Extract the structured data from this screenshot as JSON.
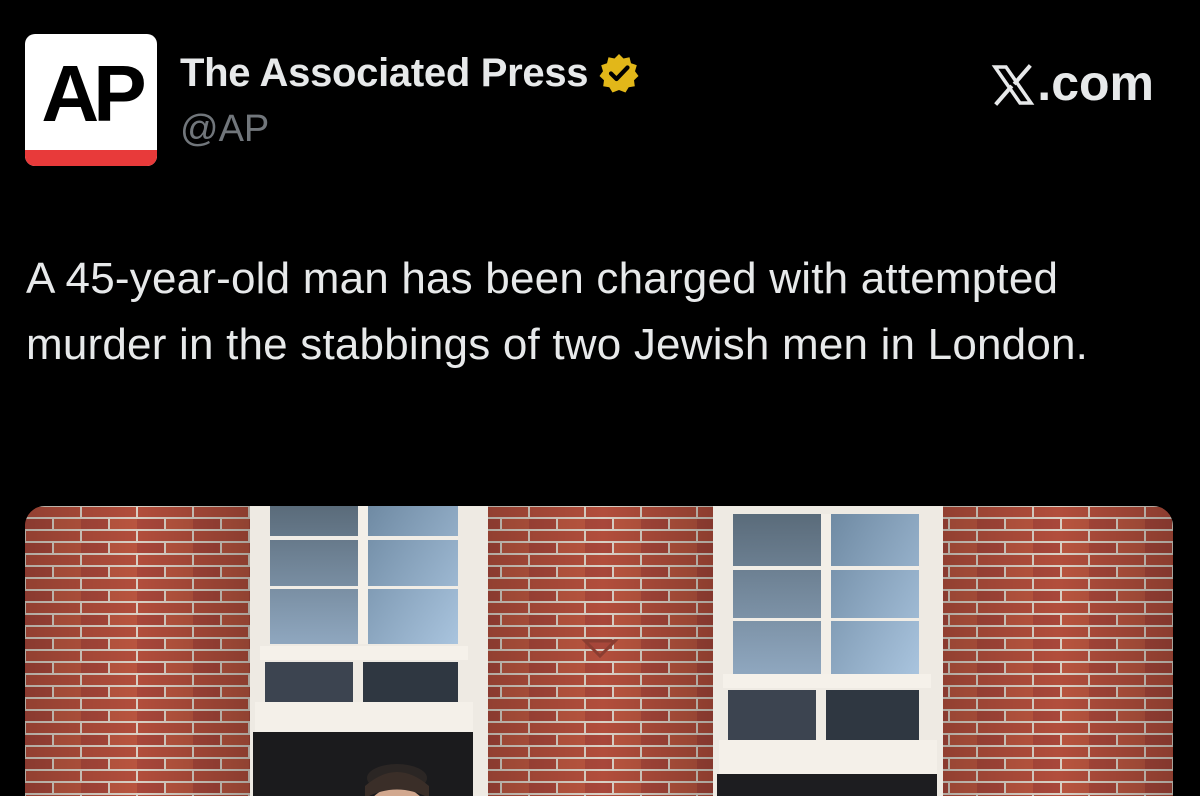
{
  "author": {
    "avatar_text": "AP",
    "display_name": "The Associated Press",
    "handle": "@AP",
    "verified": true,
    "verified_color": "#e2b719"
  },
  "site_mark": {
    "label": ".com",
    "logo_icon": "x-logo-icon"
  },
  "tweet": {
    "text": "A 45-year-old man has been charged with attempted murder in the stabbings of two Jewish men in London."
  },
  "media": {
    "icon": "photo-brick-building-windows"
  },
  "colors": {
    "background": "#000000",
    "text": "#e7e9ea",
    "secondary_text": "#71767b",
    "avatar_stripe": "#e83a3a",
    "brick": "#a4473a"
  }
}
